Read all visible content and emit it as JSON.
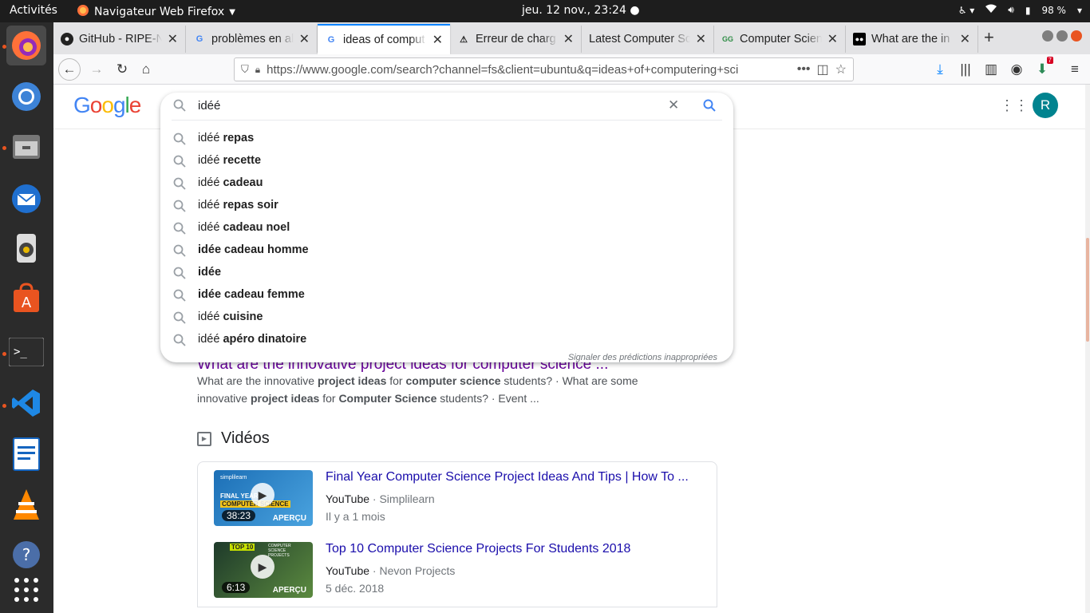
{
  "topbar": {
    "activities": "Activités",
    "app_name": "Navigateur Web Firefox",
    "clock": "jeu. 12 nov., 23:24",
    "battery": "98 %"
  },
  "dock": {
    "items": [
      "firefox-icon",
      "chromium-icon",
      "files-icon",
      "thunderbird-icon",
      "rhythmbox-icon",
      "software-center-icon",
      "terminal-icon",
      "vscode-icon",
      "libreoffice-writer-icon",
      "vlc-icon",
      "help-icon",
      "app-grid-icon"
    ]
  },
  "tabs": [
    {
      "title": "GitHub - RIPE-N",
      "favicon": "github-icon"
    },
    {
      "title": "problèmes en al",
      "favicon": "google-icon"
    },
    {
      "title": "ideas of comput",
      "favicon": "google-icon",
      "active": true
    },
    {
      "title": "Erreur de charg",
      "favicon": "warning-icon"
    },
    {
      "title": "Latest Computer Sc",
      "favicon": "none"
    },
    {
      "title": "Computer Scien",
      "favicon": "gfg-icon"
    },
    {
      "title": "What are the in",
      "favicon": "medium-icon"
    }
  ],
  "navbar": {
    "url": "https://www.google.com/search?channel=fs&client=ubuntu&q=ideas+of+computering+sci",
    "notification_badge": "7"
  },
  "google": {
    "logo": "Google",
    "query": "idéé",
    "avatar_letter": "R",
    "suggestions": [
      {
        "prefix": "idéé ",
        "bold": "repas"
      },
      {
        "prefix": "idéé ",
        "bold": "recette"
      },
      {
        "prefix": "idéé ",
        "bold": "cadeau"
      },
      {
        "prefix": "idéé ",
        "bold": "repas soir"
      },
      {
        "prefix": "idéé ",
        "bold": "cadeau noel"
      },
      {
        "prefix": "",
        "bold": "idée cadeau homme"
      },
      {
        "prefix": "",
        "bold": "idée"
      },
      {
        "prefix": "",
        "bold": "idée cadeau femme"
      },
      {
        "prefix": "idéé ",
        "bold": "cuisine"
      },
      {
        "prefix": "idéé ",
        "bold": "apéro dinatoire"
      }
    ],
    "report_link": "Signaler des prédictions inappropriées"
  },
  "results": {
    "partial_title": "What are the innovative project ideas for computer science ...",
    "snippet_parts": [
      {
        "t": "What are the innovative ",
        "b": false
      },
      {
        "t": "project ideas",
        "b": true
      },
      {
        "t": " for ",
        "b": false
      },
      {
        "t": "computer science",
        "b": true
      },
      {
        "t": " students? · What are some innovative ",
        "b": false
      },
      {
        "t": "project ideas",
        "b": true
      },
      {
        "t": " for ",
        "b": false
      },
      {
        "t": "Computer Science",
        "b": true
      },
      {
        "t": " students? · Event ...",
        "b": false
      }
    ],
    "videos_heading": "Vidéos",
    "videos": [
      {
        "title": "Final Year Computer Science Project Ideas And Tips | How To ...",
        "platform": "YouTube",
        "channel": "Simplilearn",
        "date": "Il y a 1 mois",
        "duration": "38:23",
        "preview": "APERÇU",
        "thumb_text1": "FINAL YEAR",
        "thumb_text2": "COMPUTER SCIENCE",
        "thumb_brand": "simplilearn"
      },
      {
        "title": "Top 10 Computer Science Projects For Students 2018",
        "platform": "YouTube",
        "channel": "Nevon Projects",
        "date": "5 déc. 2018",
        "duration": "6:13",
        "preview": "APERÇU",
        "thumb_text1": "TOP 10",
        "thumb_text2": "COMPUTER SCIENCE PROJECTS"
      }
    ]
  }
}
